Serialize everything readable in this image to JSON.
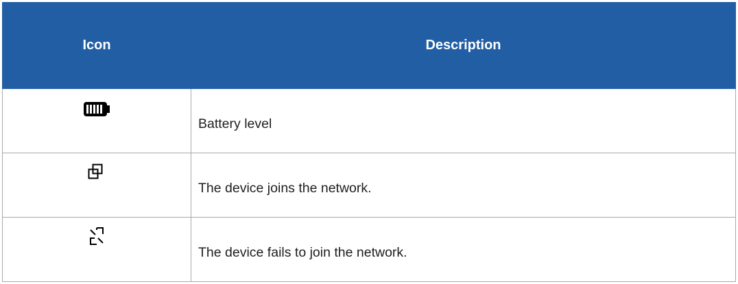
{
  "table": {
    "headers": {
      "icon": "Icon",
      "description": "Description"
    },
    "rows": [
      {
        "icon": "battery-level-icon",
        "description": "Battery level"
      },
      {
        "icon": "network-joined-icon",
        "description": "The device joins the network."
      },
      {
        "icon": "network-join-failed-icon",
        "description": "The device fails to join the network."
      }
    ]
  },
  "colors": {
    "header_bg": "#215ea4",
    "header_text": "#ffffff",
    "border": "#a8a8a8"
  }
}
